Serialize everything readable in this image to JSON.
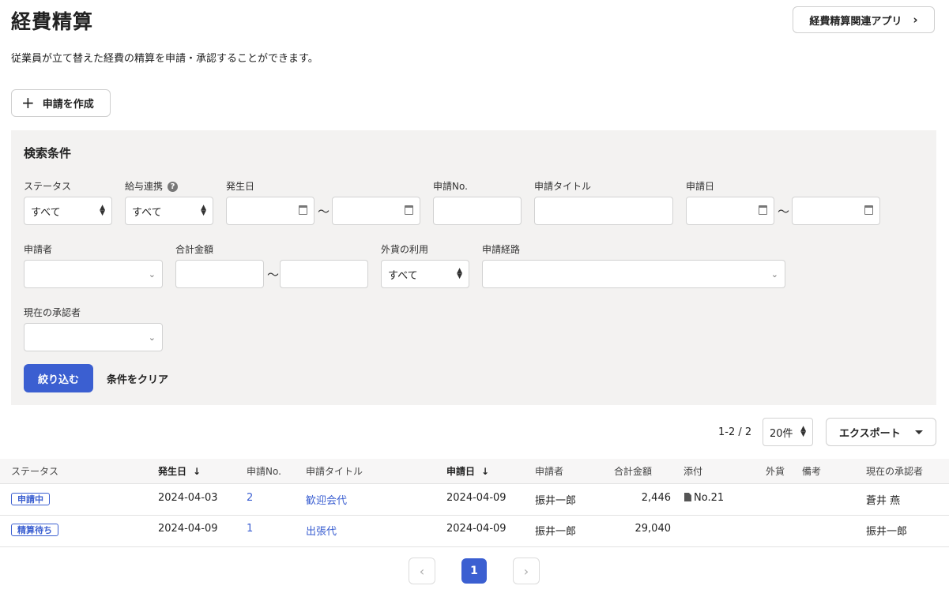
{
  "header": {
    "title": "経費精算",
    "related_apps_label": "経費精算関連アプリ",
    "description": "従業員が立て替えた経費の精算を申請・承認することができます。"
  },
  "create_button_label": "申請を作成",
  "search": {
    "title": "検索条件",
    "status": {
      "label": "ステータス",
      "value": "すべて"
    },
    "payroll": {
      "label": "給与連携",
      "value": "すべて"
    },
    "occurrence_date": {
      "label": "発生日",
      "from": "",
      "to": ""
    },
    "application_no": {
      "label": "申請No.",
      "value": ""
    },
    "application_title": {
      "label": "申請タイトル",
      "value": ""
    },
    "application_date": {
      "label": "申請日",
      "from": "",
      "to": ""
    },
    "applicant": {
      "label": "申請者",
      "value": ""
    },
    "total_amount": {
      "label": "合計金額",
      "from": "",
      "to": ""
    },
    "foreign_currency": {
      "label": "外貨の利用",
      "value": "すべて"
    },
    "route": {
      "label": "申請経路",
      "value": ""
    },
    "current_approver": {
      "label": "現在の承認者",
      "value": ""
    },
    "tilde": "～",
    "filter_label": "絞り込む",
    "clear_label": "条件をクリア"
  },
  "results": {
    "count_text": "1-2 / 2",
    "page_size": "20件",
    "export_label": "エクスポート"
  },
  "table": {
    "headers": {
      "status": "ステータス",
      "occurrence_date": "発生日",
      "application_no": "申請No.",
      "title": "申請タイトル",
      "application_date": "申請日",
      "applicant": "申請者",
      "total": "合計金額",
      "attachment": "添付",
      "foreign": "外貨",
      "note": "備考",
      "approver": "現在の承認者"
    },
    "rows": [
      {
        "status": "申請中",
        "occurrence_date": "2024-04-03",
        "no": "2",
        "title": "歓迎会代",
        "application_date": "2024-04-09",
        "applicant": "振井一郎",
        "total": "2,446",
        "attachment": "No.21",
        "foreign": "",
        "note": "",
        "approver": "蒼井 燕"
      },
      {
        "status": "精算待ち",
        "occurrence_date": "2024-04-09",
        "no": "1",
        "title": "出張代",
        "application_date": "2024-04-09",
        "applicant": "振井一郎",
        "total": "29,040",
        "attachment": "",
        "foreign": "",
        "note": "",
        "approver": "振井一郎"
      }
    ]
  },
  "pagination": {
    "current": "1"
  },
  "colors": {
    "accent": "#3b5fd1",
    "panel_bg": "#f3f2f1"
  }
}
